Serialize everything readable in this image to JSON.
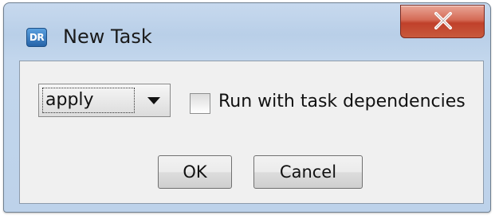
{
  "window": {
    "title": "New Task",
    "app_icon_text": "DR",
    "close_glyph": "X",
    "colors": {
      "frame": "#bdd2ea",
      "close_button": "#c85a3d",
      "content_bg": "#f0f0f0"
    }
  },
  "task_select": {
    "selected_value": "apply"
  },
  "dependencies_checkbox": {
    "label": "Run with task dependencies",
    "checked": false
  },
  "buttons": {
    "ok_label": "OK",
    "cancel_label": "Cancel"
  }
}
